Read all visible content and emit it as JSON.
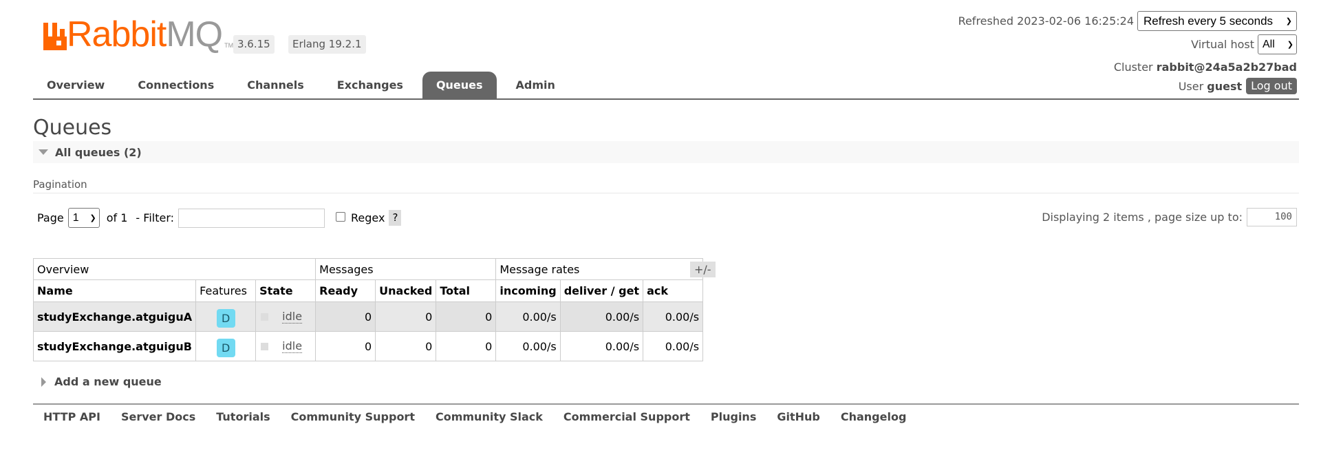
{
  "app": {
    "logo_text_rabbit": "Rabbit",
    "logo_text_mq": "MQ",
    "logo_tm": "TM",
    "version": "3.6.15",
    "erlang": "Erlang 19.2.1",
    "brand_color": "#ff6600"
  },
  "header": {
    "refreshed_label": "Refreshed 2023-02-06 16:25:24",
    "refresh_select": "Refresh every 5 seconds",
    "virtual_host_label": "Virtual host",
    "virtual_host_value": "All",
    "cluster_label": "Cluster",
    "cluster_value": "rabbit@24a5a2b27bad",
    "user_label": "User",
    "user_value": "guest",
    "logout_label": "Log out"
  },
  "tabs": [
    {
      "label": "Overview"
    },
    {
      "label": "Connections"
    },
    {
      "label": "Channels"
    },
    {
      "label": "Exchanges"
    },
    {
      "label": "Queues",
      "active": true
    },
    {
      "label": "Admin"
    }
  ],
  "page": {
    "title": "Queues",
    "section_title": "All queues (2)",
    "pagination_label": "Pagination"
  },
  "pager": {
    "page_label": "Page",
    "page_value": "1",
    "of_label": "of 1",
    "filter_label": "- Filter:",
    "filter_value": "",
    "regex_label": "Regex",
    "help_label": "?",
    "displaying_label": "Displaying 2 items , page size up to:",
    "page_size": "100"
  },
  "table": {
    "groups": [
      "Overview",
      "Messages",
      "Message rates"
    ],
    "columns": [
      "Name",
      "Features",
      "State",
      "Ready",
      "Unacked",
      "Total",
      "incoming",
      "deliver / get",
      "ack"
    ],
    "plus_minus": "+/-",
    "rows": [
      {
        "name": "studyExchange.atguiguA",
        "feature": "D",
        "state": "idle",
        "ready": "0",
        "unacked": "0",
        "total": "0",
        "incoming": "0.00/s",
        "deliver_get": "0.00/s",
        "ack": "0.00/s"
      },
      {
        "name": "studyExchange.atguiguB",
        "feature": "D",
        "state": "idle",
        "ready": "0",
        "unacked": "0",
        "total": "0",
        "incoming": "0.00/s",
        "deliver_get": "0.00/s",
        "ack": "0.00/s"
      }
    ]
  },
  "add_queue_label": "Add a new queue",
  "footer": [
    "HTTP API",
    "Server Docs",
    "Tutorials",
    "Community Support",
    "Community Slack",
    "Commercial Support",
    "Plugins",
    "GitHub",
    "Changelog"
  ]
}
